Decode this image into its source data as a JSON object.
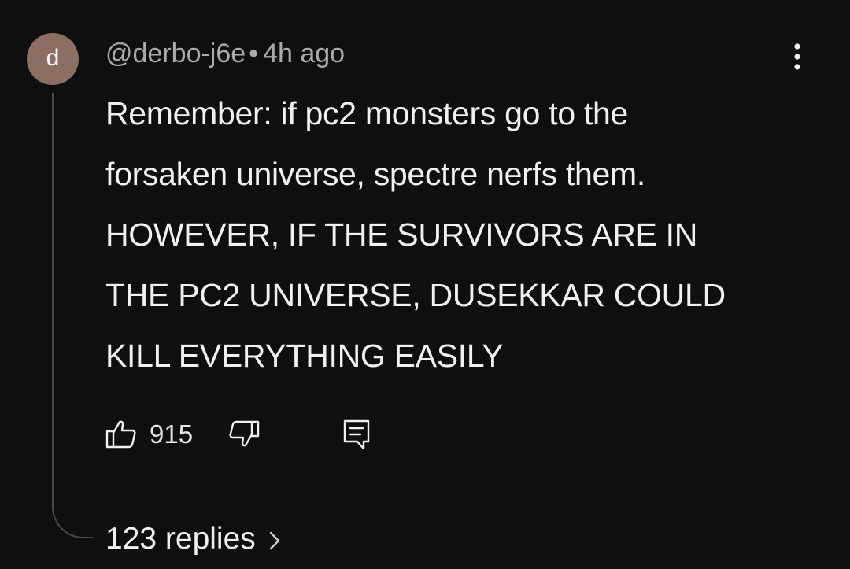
{
  "comment": {
    "avatar_letter": "d",
    "avatar_color": "#8d6e63",
    "author": "@derbo-j6e",
    "separator": "•",
    "time": "4h ago",
    "lines": [
      "Remember: if pc2 monsters go to the",
      "forsaken universe, spectre nerfs them.",
      "HOWEVER, IF THE SURVIVORS ARE IN",
      "THE PC2 UNIVERSE, DUSEKKAR COULD",
      "KILL EVERYTHING EASILY"
    ],
    "like_count": "915",
    "replies_label": "123 replies",
    "icons": {
      "menu": "more-vertical-icon",
      "like": "thumbs-up-icon",
      "dislike": "thumbs-down-icon",
      "reply": "comment-reply-icon",
      "expand": "chevron-right-icon"
    }
  }
}
